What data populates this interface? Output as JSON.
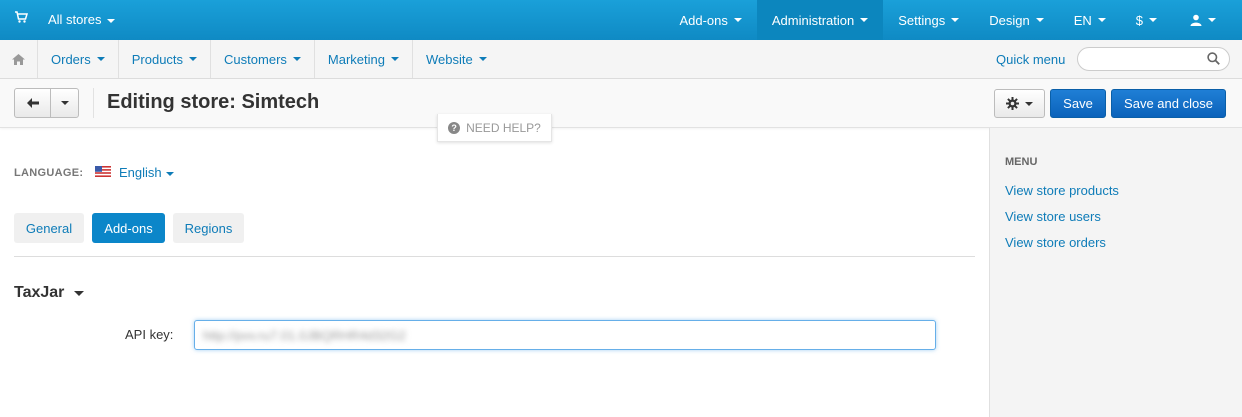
{
  "topbar": {
    "stores_label": "All stores",
    "nav": [
      "Add-ons",
      "Administration",
      "Settings",
      "Design",
      "EN",
      "$"
    ]
  },
  "subnav": {
    "items": [
      "Orders",
      "Products",
      "Customers",
      "Marketing",
      "Website"
    ],
    "quick_menu": "Quick menu",
    "search_placeholder": ""
  },
  "actionbar": {
    "title": "Editing store: Simtech",
    "save": "Save",
    "save_close": "Save and close",
    "need_help": "NEED HELP?"
  },
  "content": {
    "language_label": "LANGUAGE:",
    "language_value": "English",
    "tabs": [
      "General",
      "Add-ons",
      "Regions"
    ],
    "active_tab": "Add-ons",
    "section_title": "TaxJar",
    "api_key_label": "API key:",
    "api_key_value": "http://pvv.ru7.01.0JBQRHR4d32G2"
  },
  "sidebar": {
    "heading": "MENU",
    "links": [
      "View store products",
      "View store users",
      "View store orders"
    ]
  },
  "colors": {
    "topbar": "#1aa0d9",
    "primary": "#0b62bb",
    "link": "#0e7cb8"
  }
}
